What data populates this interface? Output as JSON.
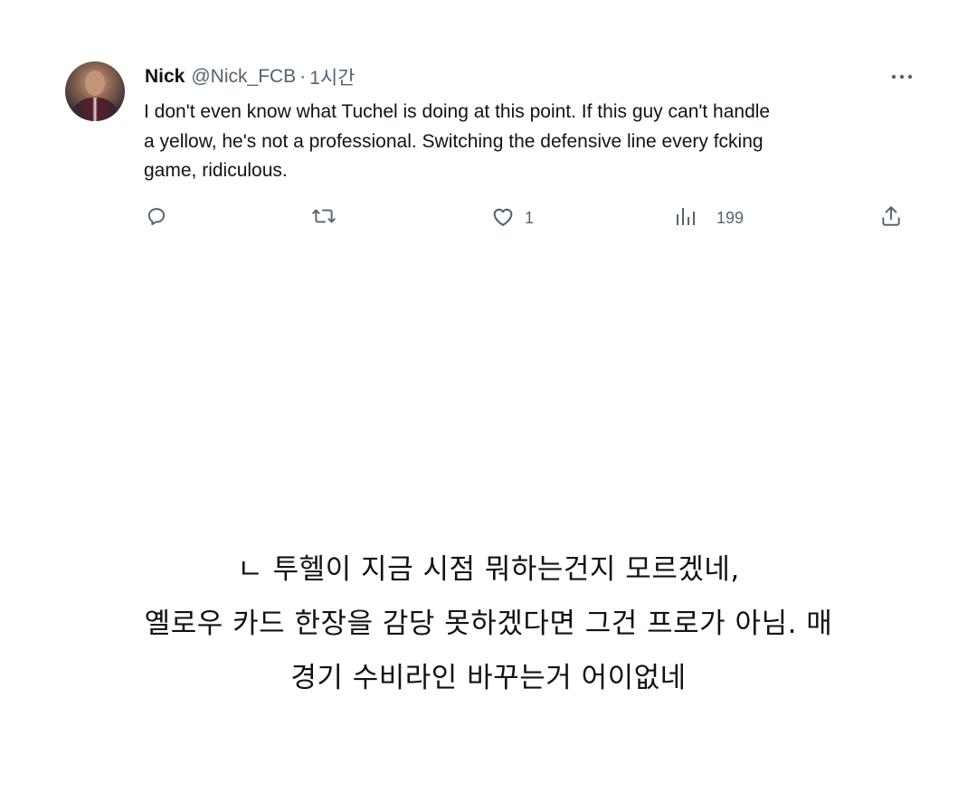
{
  "tweet": {
    "author": {
      "name": "Nick",
      "handle": "@Nick_FCB",
      "separator": "·",
      "time": "1시간"
    },
    "text_lines": [
      "I don't even know what Tuchel is doing at this point. If this guy can't handle",
      "a yellow, he's not a professional. Switching the defensive line every fcking",
      "game, ridiculous."
    ],
    "actions": {
      "reply_icon": "reply-icon",
      "retweet_icon": "retweet-icon",
      "like_icon": "heart-icon",
      "like_count": "1",
      "views_icon": "bar-chart-icon",
      "views_count": "199",
      "share_icon": "share-icon"
    },
    "more_icon": "more-dots-icon"
  },
  "caption_lines": [
    "ㄴ 투헬이 지금 시점 뭐하는건지 모르겠네,",
    "옐로우 카드 한장을 감당 못하겠다면 그건 프로가 아님. 매",
    "경기 수비라인 바꾸는거 어이없네"
  ],
  "colors": {
    "text_primary": "#0f1419",
    "text_secondary": "#536471",
    "caption": "#111111",
    "background": "#ffffff"
  }
}
